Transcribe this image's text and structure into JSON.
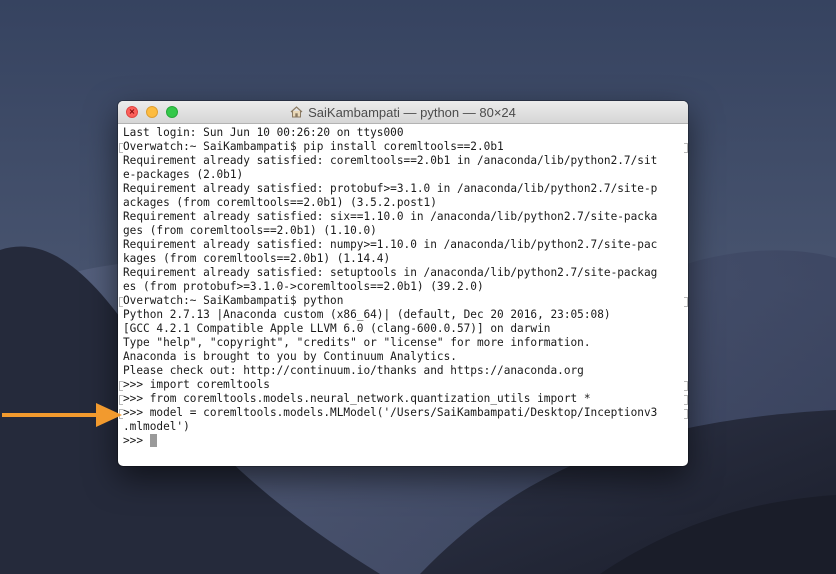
{
  "window": {
    "title": "SaiKambampati — python — 80×24",
    "title_icon": "home-icon"
  },
  "terminal_lines": [
    {
      "text": "Last login: Sun Jun 10 00:26:20 on ttys000",
      "marked": false
    },
    {
      "text": "Overwatch:~ SaiKambampati$ pip install coremltools==2.0b1",
      "marked": true
    },
    {
      "text": "Requirement already satisfied: coremltools==2.0b1 in /anaconda/lib/python2.7/sit",
      "marked": false
    },
    {
      "text": "e-packages (2.0b1)",
      "marked": false
    },
    {
      "text": "Requirement already satisfied: protobuf>=3.1.0 in /anaconda/lib/python2.7/site-p",
      "marked": false
    },
    {
      "text": "ackages (from coremltools==2.0b1) (3.5.2.post1)",
      "marked": false
    },
    {
      "text": "Requirement already satisfied: six==1.10.0 in /anaconda/lib/python2.7/site-packa",
      "marked": false
    },
    {
      "text": "ges (from coremltools==2.0b1) (1.10.0)",
      "marked": false
    },
    {
      "text": "Requirement already satisfied: numpy>=1.10.0 in /anaconda/lib/python2.7/site-pac",
      "marked": false
    },
    {
      "text": "kages (from coremltools==2.0b1) (1.14.4)",
      "marked": false
    },
    {
      "text": "Requirement already satisfied: setuptools in /anaconda/lib/python2.7/site-packag",
      "marked": false
    },
    {
      "text": "es (from protobuf>=3.1.0->coremltools==2.0b1) (39.2.0)",
      "marked": false
    },
    {
      "text": "Overwatch:~ SaiKambampati$ python",
      "marked": true
    },
    {
      "text": "Python 2.7.13 |Anaconda custom (x86_64)| (default, Dec 20 2016, 23:05:08)",
      "marked": false
    },
    {
      "text": "[GCC 4.2.1 Compatible Apple LLVM 6.0 (clang-600.0.57)] on darwin",
      "marked": false
    },
    {
      "text": "Type \"help\", \"copyright\", \"credits\" or \"license\" for more information.",
      "marked": false
    },
    {
      "text": "Anaconda is brought to you by Continuum Analytics.",
      "marked": false
    },
    {
      "text": "Please check out: http://continuum.io/thanks and https://anaconda.org",
      "marked": false
    },
    {
      "text": ">>> import coremltools",
      "marked": true
    },
    {
      "text": ">>> from coremltools.models.neural_network.quantization_utils import *",
      "marked": true
    },
    {
      "text": ">>> model = coremltools.models.MLModel('/Users/SaiKambampati/Desktop/Inceptionv3",
      "marked": true
    },
    {
      "text": ".mlmodel')",
      "marked": false
    },
    {
      "text": ">>> ",
      "marked": false,
      "cursor": true
    }
  ],
  "annotation": {
    "arrow_color": "#f29a2e"
  }
}
